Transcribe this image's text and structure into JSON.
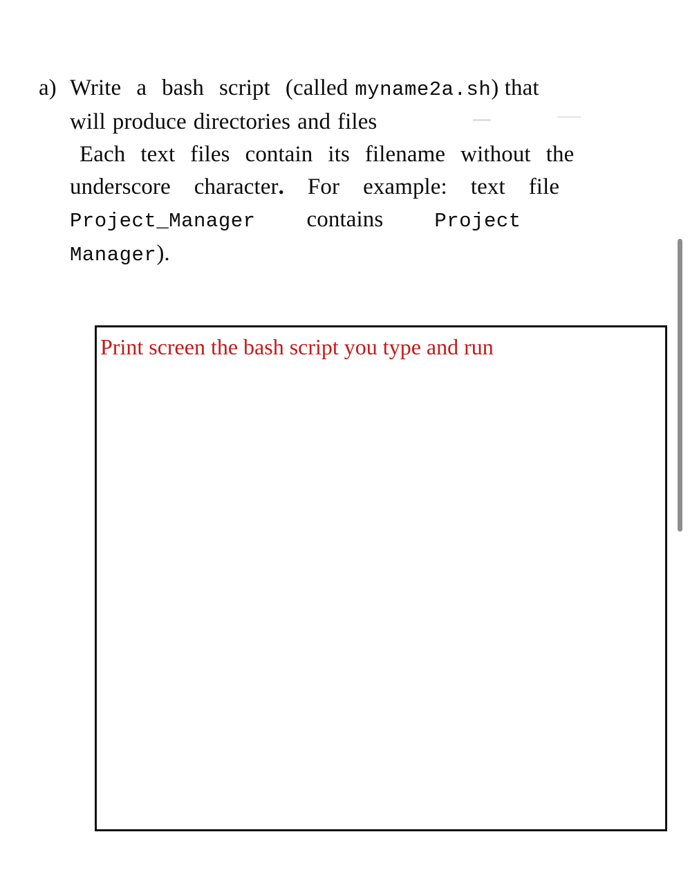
{
  "document": {
    "background_color": "#ffffff",
    "question_marker": "a)",
    "lines": [
      {
        "id": "line1",
        "segments": [
          {
            "text": "Write",
            "style": "serif"
          },
          {
            "text": "a",
            "style": "serif"
          },
          {
            "text": "bash",
            "style": "serif"
          },
          {
            "text": "script",
            "style": "serif"
          },
          {
            "text": "(called",
            "style": "serif"
          },
          {
            "text": "myname2a.sh",
            "style": "mono"
          },
          {
            "text": ") that",
            "style": "serif"
          }
        ],
        "plain": "Write a bash script (called myname2a.sh) that"
      },
      {
        "id": "line2",
        "plain": "will produce directories and files"
      },
      {
        "id": "line3",
        "plain": "Each text files contain its filename without the"
      },
      {
        "id": "line4",
        "plain": "underscore character. For example: text file"
      },
      {
        "id": "line5",
        "segments": [
          {
            "text": "Project_Manager",
            "style": "mono"
          },
          {
            "text": "contains",
            "style": "serif"
          },
          {
            "text": "Project",
            "style": "mono"
          }
        ],
        "plain": "Project_Manager contains Project"
      },
      {
        "id": "line6",
        "segments": [
          {
            "text": "Manager",
            "style": "mono"
          },
          {
            "text": ").",
            "style": "serif"
          }
        ],
        "plain": "Manager)."
      }
    ],
    "words": {
      "write": "Write",
      "a": "a",
      "bash": "bash",
      "script": "script",
      "called_open": "(called",
      "filename_mono": "myname2a.sh",
      "close_that": ") that",
      "will": "will",
      "produce": "produce",
      "directories": "directories",
      "and": "and",
      "files": "files",
      "each": "Each",
      "text": "text",
      "files2": "files",
      "contain": "contain",
      "its": "its",
      "filename": "filename",
      "without": "without",
      "the": "the",
      "underscore": "underscore",
      "character": "character",
      "period": ".",
      "for": "For",
      "example": "example:",
      "text2": "text",
      "file": "file",
      "project_manager": "Project_Manager",
      "contains": "contains",
      "project": "Project",
      "manager": "Manager",
      "close_paren_period": ")."
    }
  },
  "answer_box": {
    "prompt_text": "Print screen the bash script you type and run",
    "prompt_color": "#c61919",
    "border_color": "#111111"
  },
  "scrollbar": {
    "thumb_color": "#8e8e8e",
    "orientation": "vertical"
  }
}
